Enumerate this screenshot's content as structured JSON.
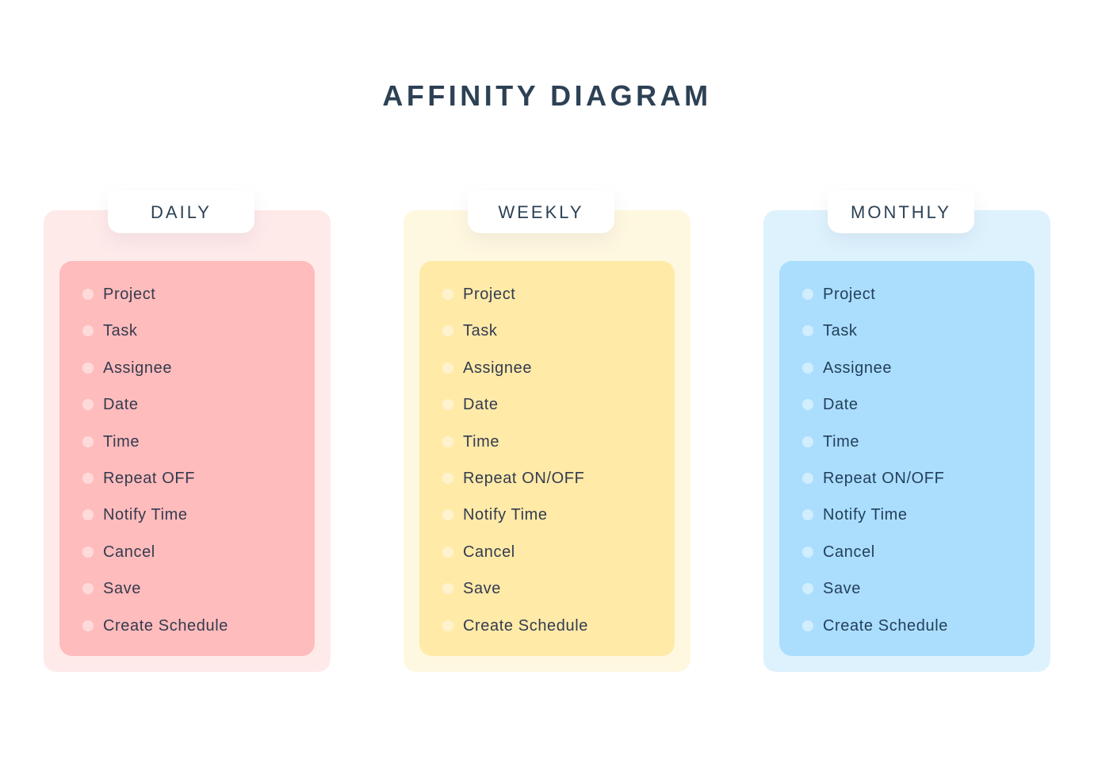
{
  "title": "AFFINITY DIAGRAM",
  "columns": [
    {
      "label": "DAILY",
      "colors": {
        "outer": "#ffeaea",
        "inner": "#ffbcbc"
      },
      "items": [
        "Project",
        "Task",
        "Assignee",
        "Date",
        "Time",
        "Repeat OFF",
        "Notify Time",
        "Cancel",
        "Save",
        "Create Schedule"
      ]
    },
    {
      "label": "WEEKLY",
      "colors": {
        "outer": "#fff8e0",
        "inner": "#ffeaa8"
      },
      "items": [
        "Project",
        "Task",
        "Assignee",
        "Date",
        "Time",
        "Repeat ON/OFF",
        "Notify Time",
        "Cancel",
        "Save",
        "Create Schedule"
      ]
    },
    {
      "label": "MONTHLY",
      "colors": {
        "outer": "#def2fe",
        "inner": "#abdefd"
      },
      "items": [
        "Project",
        "Task",
        "Assignee",
        "Date",
        "Time",
        "Repeat ON/OFF",
        "Notify Time",
        "Cancel",
        "Save",
        "Create Schedule"
      ]
    }
  ]
}
